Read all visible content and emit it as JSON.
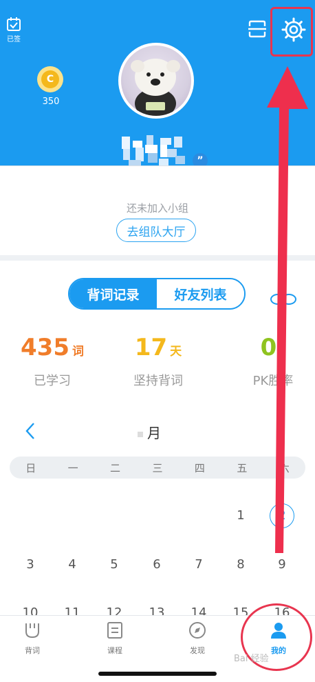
{
  "header": {
    "checkin_label": "已签",
    "coin_count": "350",
    "coin_symbol": "C",
    "quote_symbol": "”"
  },
  "group": {
    "status_text": "还未加入小组",
    "button_label": "去组队大厅"
  },
  "tabs_segment": {
    "active": "背词记录",
    "inactive": "好友列表"
  },
  "stats": [
    {
      "value": "435",
      "unit": "词",
      "label": "已学习",
      "color": "#f07d2a"
    },
    {
      "value": "17",
      "unit": "天",
      "label": "坚持背词",
      "color": "#f4b81c"
    },
    {
      "value": "0",
      "unit": "%",
      "label": "PK胜率",
      "color": "#8fc31f"
    }
  ],
  "calendar": {
    "prev_icon": "chevron-left-icon",
    "month_label": "月",
    "weekdays": [
      "日",
      "一",
      "二",
      "三",
      "四",
      "五",
      "六"
    ],
    "row1": [
      "1",
      "2"
    ],
    "row2": [
      "3",
      "4",
      "5",
      "6",
      "7",
      "8",
      "9"
    ],
    "row3": [
      "10",
      "11",
      "12",
      "13",
      "14",
      "15",
      "16"
    ]
  },
  "tabbar": {
    "items": [
      {
        "label": "背词",
        "icon": "word-icon"
      },
      {
        "label": "课程",
        "icon": "course-icon"
      },
      {
        "label": "发现",
        "icon": "compass-icon"
      },
      {
        "label": "我的",
        "icon": "profile-icon"
      }
    ]
  },
  "watermark": "Bai 经验",
  "colors": {
    "brand": "#1b9bf0",
    "annotation": "#e8354f"
  }
}
